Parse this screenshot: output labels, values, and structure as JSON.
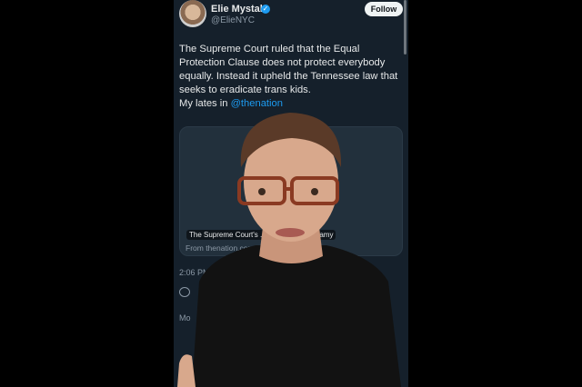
{
  "tweet": {
    "display_name": "Elie Mystal",
    "handle": "@ElieNYC",
    "follow_label": "Follow",
    "text_lines": [
      "The Supreme Court ruled that the Equal",
      "Protection Clause does not protect everybody",
      "equally. Instead it upheld the Tennessee law that",
      "seeks to eradicate trans kids.",
      "My lates in "
    ],
    "mention": "@thenation",
    "card_title": "The Supreme Court's ... n Will Live In Infamy",
    "card_source": "From thenation.com",
    "timestamp": "2:06 PM",
    "more_prefix": "Mo"
  },
  "colors": {
    "background": "#15202b",
    "accent": "#1d9bf0",
    "text": "#e7e9ea",
    "muted": "#8b98a5"
  },
  "icons": [
    "verified-badge-icon",
    "reply-icon"
  ]
}
